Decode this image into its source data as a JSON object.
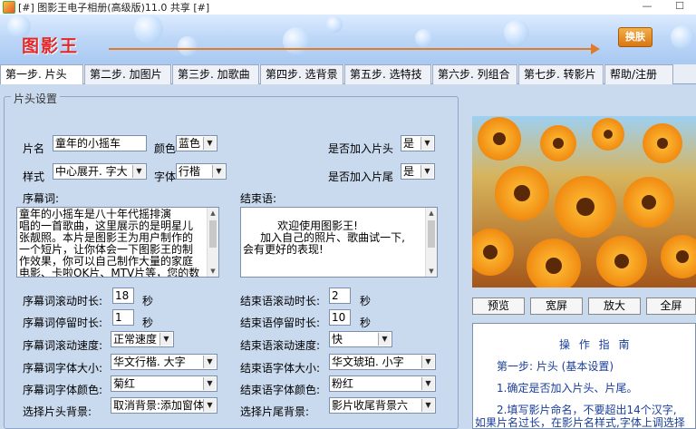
{
  "window": {
    "title": "[#] 图影王电子相册(高级版)11.0 共享 [#]",
    "minimize": "—",
    "maximize": "☐"
  },
  "banner": {
    "logo": "图影王",
    "skin_button": "换肤"
  },
  "tabs": [
    {
      "label": "第一步. 片头",
      "active": true
    },
    {
      "label": "第二步. 加图片"
    },
    {
      "label": "第三步. 加歌曲"
    },
    {
      "label": "第四步. 选背景"
    },
    {
      "label": "第五步. 选特技"
    },
    {
      "label": "第六步. 列组合"
    },
    {
      "label": "第七步. 转影片"
    },
    {
      "label": "帮助/注册"
    }
  ],
  "panel": {
    "legend": "片头设置",
    "title_label": "片名",
    "title_value": "童年的小摇车",
    "color_label": "颜色",
    "color_value": "蓝色",
    "style_label": "样式",
    "style_value": "中心展开. 字大",
    "font_label": "字体",
    "font_value": "行楷",
    "add_head_label": "是否加入片头",
    "add_head_value": "是",
    "add_tail_label": "是否加入片尾",
    "add_tail_value": "是",
    "prologue_label": "序幕词:",
    "prologue_lines": [
      "      童年的小摇车是八十年代摇排演",
      "唱的一首歌曲，这里展示的是明星儿",
      "张靓照。本片是图影王为用户制作的",
      "一个短片，让你体会一下图影王的制",
      "作效果，你可以自己制作大量的家庭",
      "电影、卡啦OK片、MTV片等，您的数码"
    ],
    "epilogue_label": "结束语:",
    "epilogue_lines": [
      "",
      "          欢迎使用图影王!",
      "     加入自己的照片、歌曲试一下,",
      "会有更好的表现!"
    ],
    "pro_scroll_label": "序幕词滚动时长:",
    "pro_scroll_value": "18",
    "pro_stay_label": "序幕词停留时长:",
    "pro_stay_value": "1",
    "seconds": "秒",
    "epi_scroll_label": "结束语滚动时长:",
    "epi_scroll_value": "2",
    "epi_stay_label": "结束语停留时长:",
    "epi_stay_value": "10",
    "pro_speed_label": "序幕词滚动速度:",
    "pro_speed_value": "正常速度",
    "epi_speed_label": "结束语滚动速度:",
    "epi_speed_value": "快",
    "pro_fontsize_label": "序幕词字体大小:",
    "pro_fontsize_value": "华文行楷. 大字",
    "epi_fontsize_label": "结束语字体大小:",
    "epi_fontsize_value": "华文琥珀. 小字",
    "pro_fontcolor_label": "序幕词字体颜色:",
    "pro_fontcolor_value": "菊红",
    "epi_fontcolor_label": "结束语字体颜色:",
    "epi_fontcolor_value": "粉红",
    "head_bg_label": "选择片头背景:",
    "head_bg_value": "取消背景:添加窗体",
    "tail_bg_label": "选择片尾背景:",
    "tail_bg_value": "影片收尾背景六"
  },
  "preview_buttons": {
    "preview": "预览",
    "wide": "宽屏",
    "enlarge": "放大",
    "fullscreen": "全屏"
  },
  "guide": {
    "title": "操 作 指 南",
    "step": "第一步: 片头 (基本设置)",
    "line1": "1.确定是否加入片头、片尾。",
    "line2": "2.填写影片命名，不要超出14个汉字,",
    "line3": "如果片名过长，在影片名样式,字体上调选择"
  },
  "colors": {
    "accent": "#e07b2a",
    "logo": "#e0282a",
    "guide_text": "#1a3e9a"
  }
}
